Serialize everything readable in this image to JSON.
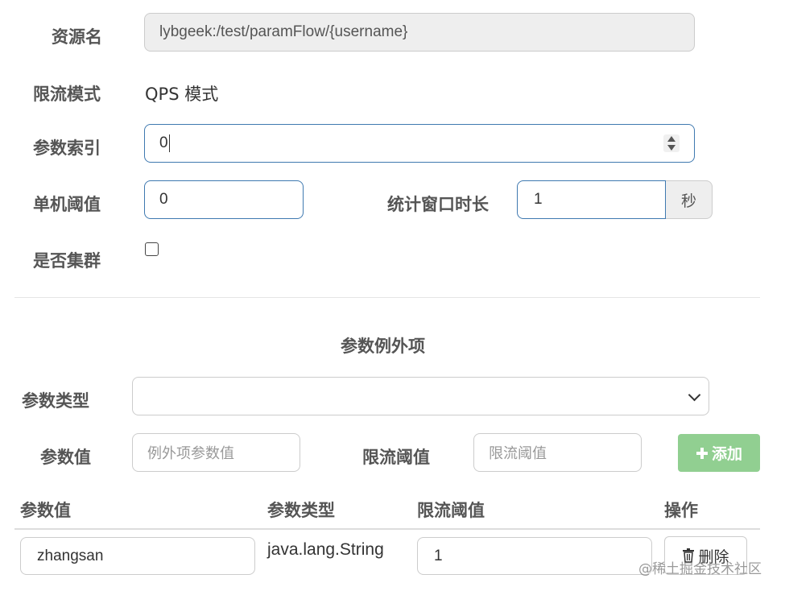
{
  "form": {
    "resource_label": "资源名",
    "resource_value": "lybgeek:/test/paramFlow/{username}",
    "mode_label": "限流模式",
    "mode_value": "QPS 模式",
    "param_index_label": "参数索引",
    "param_index_value": "0",
    "threshold_label": "单机阈值",
    "threshold_value": "0",
    "window_label": "统计窗口时长",
    "window_value": "1",
    "window_unit": "秒",
    "cluster_label": "是否集群",
    "cluster_checked": false
  },
  "exceptions": {
    "title": "参数例外项",
    "type_label": "参数类型",
    "type_value": "",
    "value_label": "参数值",
    "value_placeholder": "例外项参数值",
    "limit_label": "限流阈值",
    "limit_placeholder": "限流阈值",
    "add_icon": "plus-icon",
    "add_label": "添加",
    "add_color": "#91cf91"
  },
  "table": {
    "headers": [
      "参数值",
      "参数类型",
      "限流阈值",
      "操作"
    ],
    "rows": [
      {
        "value": "zhangsan",
        "type": "java.lang.String",
        "limit": "1",
        "action_label": "删除",
        "action_icon": "trash-icon"
      }
    ]
  },
  "watermark": "@稀土掘金技术社区"
}
